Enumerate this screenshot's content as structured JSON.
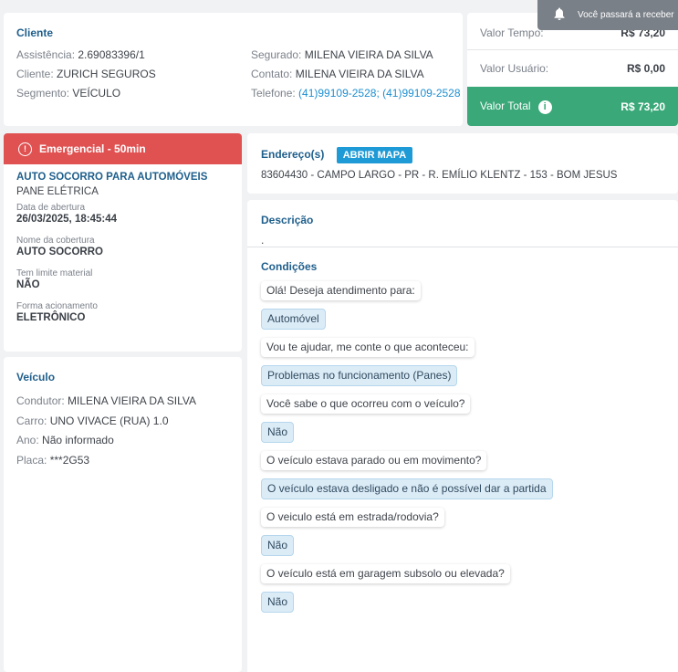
{
  "toast": {
    "text": "Você passará a receber"
  },
  "client": {
    "title": "Cliente",
    "left": [
      {
        "label": "Assistência:",
        "value": "2.69083396/1"
      },
      {
        "label": "Cliente:",
        "value": "ZURICH SEGUROS"
      },
      {
        "label": "Segmento:",
        "value": "VEÍCULO"
      }
    ],
    "right": [
      {
        "label": "Segurado:",
        "value": "MILENA VIEIRA DA SILVA"
      },
      {
        "label": "Contato:",
        "value": "MILENA VIEIRA DA SILVA"
      },
      {
        "label": "Telefone:",
        "value": "(41)99109-2528; (41)99109-2528"
      }
    ]
  },
  "values": {
    "tempo": {
      "label": "Valor Tempo:",
      "value": "R$ 73,20"
    },
    "usuario": {
      "label": "Valor Usuário:",
      "value": "R$ 0,00"
    },
    "total": {
      "label": "Valor Total",
      "value": "R$ 73,20"
    }
  },
  "service": {
    "banner": "Emergencial - 50min",
    "title": "AUTO SOCORRO PARA AUTOMÓVEIS",
    "subtitle": "PANE ELÉTRICA",
    "fields": [
      {
        "label": "Data de abertura",
        "value": "26/03/2025, 18:45:44"
      },
      {
        "label": "Nome da cobertura",
        "value": "AUTO SOCORRO"
      },
      {
        "label": "Tem limite material",
        "value": "NÃO"
      },
      {
        "label": "Forma acionamento",
        "value": "ELETRÔNICO"
      }
    ]
  },
  "vehicle": {
    "title": "Veículo",
    "lines": [
      {
        "label": "Condutor:",
        "value": "MILENA VIEIRA DA SILVA"
      },
      {
        "label": "Carro:",
        "value": "UNO VIVACE (RUA) 1.0"
      },
      {
        "label": "Ano:",
        "value": "Não informado"
      },
      {
        "label": "Placa:",
        "value": "***2G53"
      }
    ]
  },
  "address": {
    "title": "Endereço(s)",
    "map_button": "ABRIR MAPA",
    "text": "83604430 - CAMPO LARGO - PR - R. EMÍLIO KLENTZ - 153 - BOM JESUS"
  },
  "description": {
    "title": "Descrição",
    "text": "."
  },
  "conditions": {
    "title": "Condições",
    "messages": [
      {
        "type": "q",
        "text": "Olá! Deseja atendimento para:"
      },
      {
        "type": "a",
        "text": "Automóvel"
      },
      {
        "type": "q",
        "text": "Vou te ajudar, me conte o que aconteceu:"
      },
      {
        "type": "a",
        "text": "Problemas no funcionamento (Panes)"
      },
      {
        "type": "q",
        "text": "Você sabe o que ocorreu com o veículo?"
      },
      {
        "type": "a",
        "text": "Não"
      },
      {
        "type": "q",
        "text": "O veículo estava parado ou em movimento?"
      },
      {
        "type": "a",
        "text": "O veículo estava desligado e não é possível dar a partida"
      },
      {
        "type": "q",
        "text": "O veiculo está em estrada/rodovia?"
      },
      {
        "type": "a",
        "text": "Não"
      },
      {
        "type": "q",
        "text": "O veículo está em garagem subsolo ou elevada?"
      },
      {
        "type": "a",
        "text": "Não"
      }
    ]
  },
  "colors": {
    "accent": "#1f5f8c",
    "danger": "#e05252",
    "success": "#3aa878",
    "link": "#1e8fd1"
  }
}
